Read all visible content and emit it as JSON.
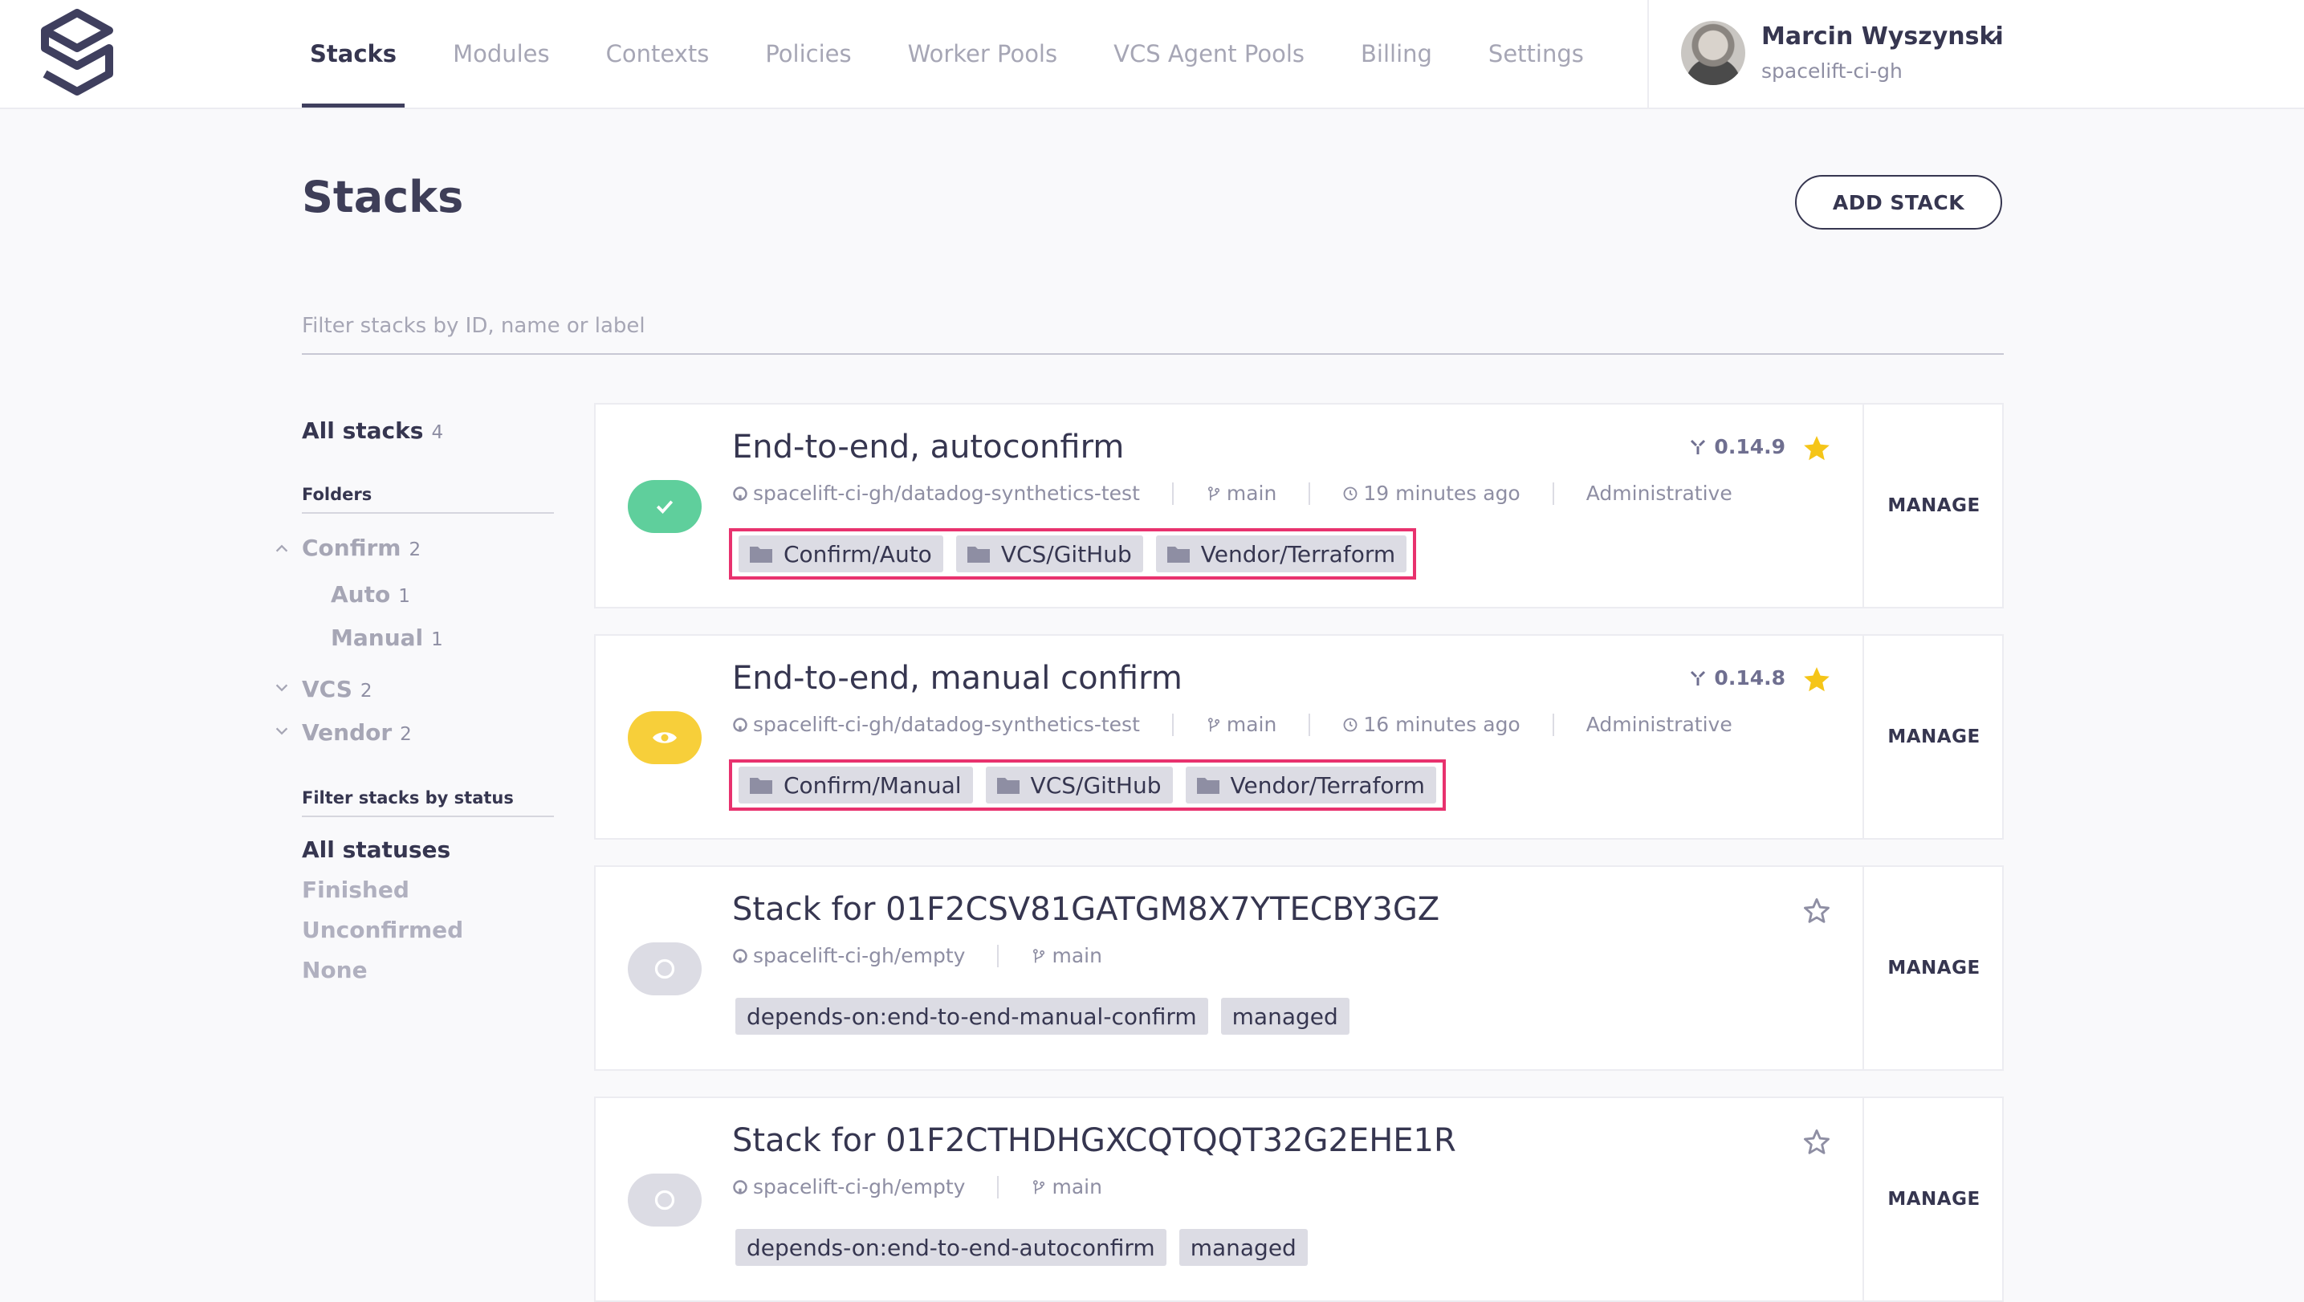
{
  "nav": {
    "items": [
      "Stacks",
      "Modules",
      "Contexts",
      "Policies",
      "Worker Pools",
      "VCS Agent Pools",
      "Billing",
      "Settings"
    ],
    "active": "Stacks"
  },
  "user": {
    "name": "Marcin Wyszynski",
    "org": "spacelift-ci-gh"
  },
  "page": {
    "title": "Stacks",
    "add_button": "ADD STACK"
  },
  "filter": {
    "placeholder": "Filter stacks by ID, name or label",
    "value": ""
  },
  "sidebar": {
    "all_stacks": {
      "label": "All stacks",
      "count": "4"
    },
    "folders_heading": "Folders",
    "folders": [
      {
        "label": "Confirm",
        "count": "2",
        "expanded": true,
        "children": [
          {
            "label": "Auto",
            "count": "1"
          },
          {
            "label": "Manual",
            "count": "1"
          }
        ]
      },
      {
        "label": "VCS",
        "count": "2",
        "expanded": false
      },
      {
        "label": "Vendor",
        "count": "2",
        "expanded": false
      }
    ],
    "status_heading": "Filter stacks by status",
    "statuses": [
      "All statuses",
      "Finished",
      "Unconfirmed",
      "None"
    ],
    "active_status": "All statuses"
  },
  "stacks": [
    {
      "name": "End-to-end, autoconfirm",
      "state": "finished",
      "repo": "spacelift-ci-gh/datadog-synthetics-test",
      "branch": "main",
      "time": "19 minutes ago",
      "extra": "Administrative",
      "version": "0.14.9",
      "starred": true,
      "labels": [
        "Confirm/Auto",
        "VCS/GitHub",
        "Vendor/Terraform"
      ],
      "labels_are_folders": true,
      "manage": "MANAGE"
    },
    {
      "name": "End-to-end, manual confirm",
      "state": "unconfirmed",
      "repo": "spacelift-ci-gh/datadog-synthetics-test",
      "branch": "main",
      "time": "16 minutes ago",
      "extra": "Administrative",
      "version": "0.14.8",
      "starred": true,
      "labels": [
        "Confirm/Manual",
        "VCS/GitHub",
        "Vendor/Terraform"
      ],
      "labels_are_folders": true,
      "manage": "MANAGE"
    },
    {
      "name": "Stack for 01F2CSV81GATGM8X7YTECBY3GZ",
      "state": "none",
      "repo": "spacelift-ci-gh/empty",
      "branch": "main",
      "starred": false,
      "labels": [
        "depends-on:end-to-end-manual-confirm",
        "managed"
      ],
      "labels_are_folders": false,
      "manage": "MANAGE"
    },
    {
      "name": "Stack for 01F2CTHDHGXCQTQQT32G2EHE1R",
      "state": "none",
      "repo": "spacelift-ci-gh/empty",
      "branch": "main",
      "starred": false,
      "labels": [
        "depends-on:end-to-end-autoconfirm",
        "managed"
      ],
      "labels_are_folders": false,
      "manage": "MANAGE"
    }
  ],
  "colors": {
    "accent": "#363650",
    "finished": "#5fcf9c",
    "unconfirmed": "#f7cf3a",
    "none": "#dcdce4",
    "highlight": "#e8326e",
    "star": "#f5c518"
  },
  "icons": [
    "spacelift-logo-icon",
    "chevron-down-icon",
    "github-icon",
    "branch-icon",
    "clock-icon",
    "terraform-icon",
    "star-icon",
    "folder-icon",
    "check-icon",
    "eye-icon",
    "circle-icon"
  ]
}
